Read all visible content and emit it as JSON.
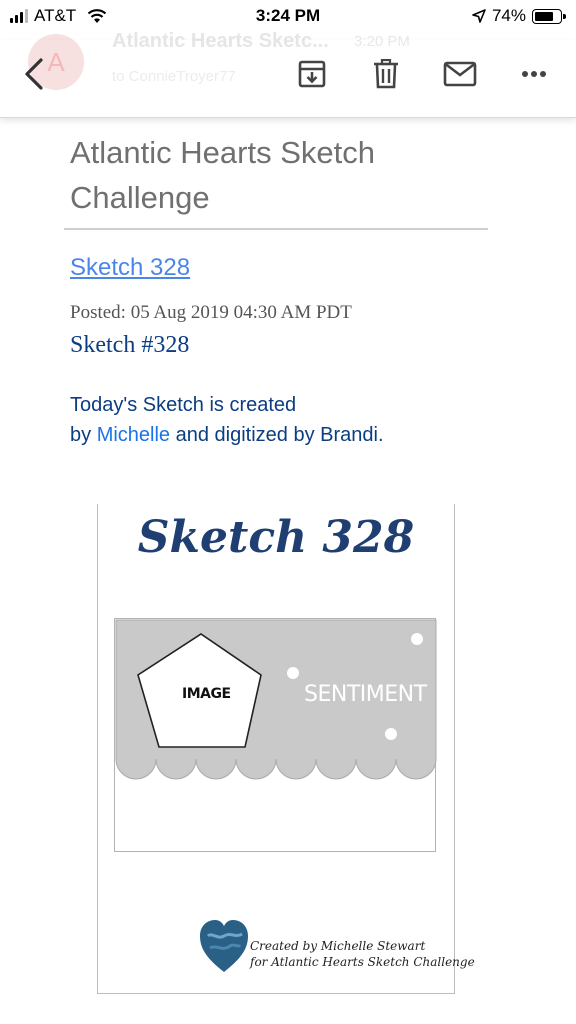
{
  "status_bar": {
    "carrier": "AT&T",
    "time": "3:24 PM",
    "battery": "74%",
    "battery_level": 0.74
  },
  "email_header": {
    "avatar_letter": "A",
    "sender": "Atlantic Hearts Sketc...",
    "time": "3:20 PM",
    "recipient": "to ConnieTroyer77"
  },
  "toolbar": {
    "back_icon": "chevron-left-icon",
    "archive_icon": "archive-icon",
    "delete_icon": "trash-icon",
    "mark_unread_icon": "mail-icon",
    "more_icon": "more-horizontal-icon"
  },
  "post": {
    "blog_title": "Atlantic Hearts Sketch Challenge",
    "link_text": "Sketch 328",
    "posted": "Posted: 05 Aug 2019 04:30 AM PDT",
    "heading": "Sketch #328",
    "intro_part1": "Today's Sketch is created",
    "intro_by": "by",
    "intro_link": "Michelle",
    "intro_part2": "and digitized by Brandi."
  },
  "sketch_image": {
    "title": "Sketch 328",
    "image_label": "IMAGE",
    "sentiment_label": "SENTIMENT",
    "credit_line1": "Created by Michelle Stewart",
    "credit_line2": "for Atlantic Hearts Sketch Challenge"
  },
  "colors": {
    "link": "#4a86e8",
    "heading_blue": "#0b3d82",
    "sketch_title": "#1f3f73",
    "panel_gray": "#c9c9c9"
  }
}
